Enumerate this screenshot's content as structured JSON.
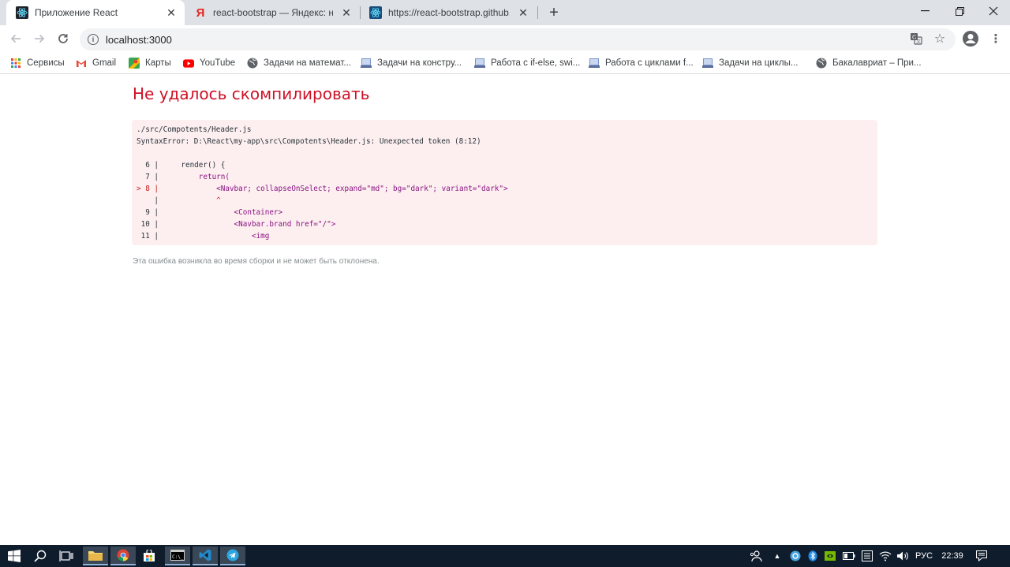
{
  "tabs": [
    {
      "title": "Приложение React",
      "favicon": "react-icon"
    },
    {
      "title": "react-bootstrap — Яндекс: нашё",
      "favicon": "yandex-icon"
    },
    {
      "title": "https://react-bootstrap.github.io/",
      "favicon": "react-bootstrap-icon"
    }
  ],
  "toolbar": {
    "url": "localhost:3000"
  },
  "bookmarks": [
    {
      "label": "Сервисы",
      "icon": "apps-grid-icon"
    },
    {
      "label": "Gmail",
      "icon": "gmail-icon"
    },
    {
      "label": "Карты",
      "icon": "maps-icon"
    },
    {
      "label": "YouTube",
      "icon": "youtube-icon"
    },
    {
      "label": "Задачи на математ...",
      "icon": "globe-icon"
    },
    {
      "label": "Задачи на констру...",
      "icon": "page-icon"
    },
    {
      "label": "Работа с if-else, swi...",
      "icon": "page-icon"
    },
    {
      "label": "Работа с циклами f...",
      "icon": "page-icon"
    },
    {
      "label": "Задачи на циклы...",
      "icon": "page-icon"
    },
    {
      "label": "Бакалавриат – При...",
      "icon": "globe-icon"
    }
  ],
  "page": {
    "title": "Не удалось скомпилировать",
    "file": "./src/Compotents/Header.js",
    "error": "SyntaxError: D:\\React\\my-app\\src\\Compotents\\Header.js: Unexpected token (8:12)",
    "code": [
      {
        "gutter": "  6 |",
        "text": "    render() {"
      },
      {
        "gutter": "  7 |",
        "text": "        return("
      },
      {
        "gutter": "> 8 |",
        "text": "            <Navbar; collapseOnSelect; expand=\"md\"; bg=\"dark\"; variant=\"dark\">"
      },
      {
        "gutter": "    |",
        "text": "            ^"
      },
      {
        "gutter": "  9 |",
        "text": "                <Container>"
      },
      {
        "gutter": " 10 |",
        "text": "                <Navbar.brand href=\"/\">"
      },
      {
        "gutter": " 11 |",
        "text": "                    <img"
      }
    ],
    "note": "Эта ошибка возникла во время сборки и не может быть отклонена."
  },
  "taskbar": {
    "lang": "РУС",
    "time": "22:39"
  },
  "colors": {
    "error_red": "#ce1126",
    "error_bg": "#fdeff0",
    "tab_strip": "#dee1e6",
    "taskbar": "#0f1c2b"
  }
}
